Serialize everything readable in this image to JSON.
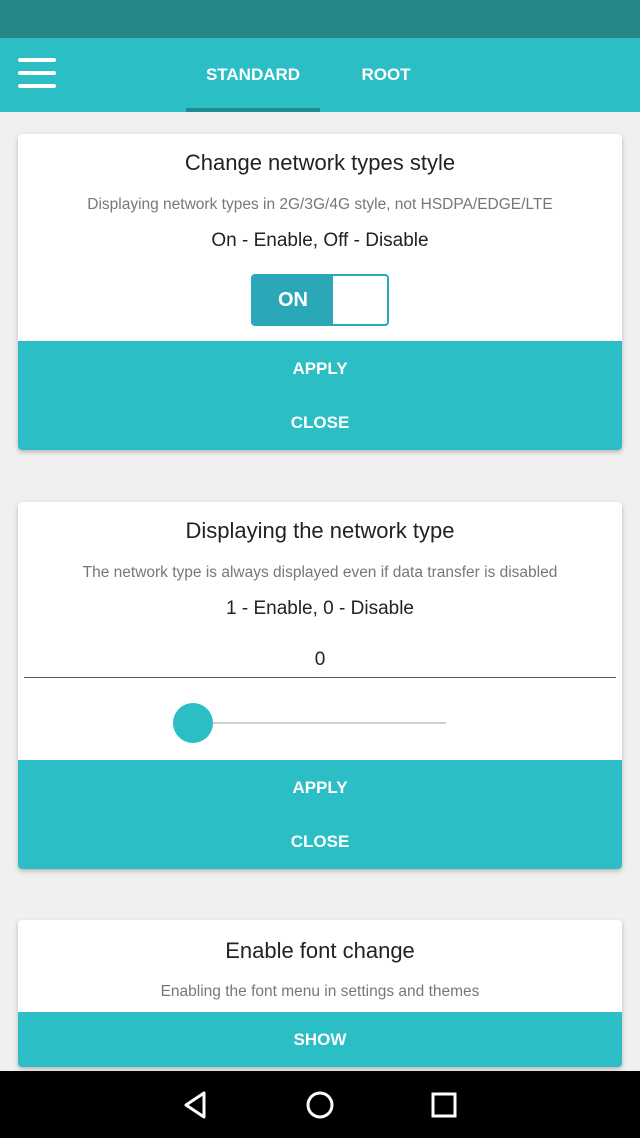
{
  "colors": {
    "status_bar": "#26878a",
    "primary": "#2bbec5",
    "tab_indicator": "#1e8c92",
    "toggle": "#2aa8b8",
    "nav_bar": "#000000"
  },
  "icons": {
    "menu": "hamburger-icon",
    "back": "back-triangle-icon",
    "home": "home-circle-icon",
    "recents": "recents-square-icon"
  },
  "tabs": [
    {
      "label": "STANDARD",
      "selected": true
    },
    {
      "label": "ROOT",
      "selected": false
    }
  ],
  "cards": [
    {
      "title": "Change network types style",
      "description": "Displaying network types in 2G/3G/4G style, not HSDPA/EDGE/LTE",
      "hint": "On - Enable, Off - Disable",
      "toggle_label": "ON",
      "apply_label": "APPLY",
      "close_label": "CLOSE"
    },
    {
      "title": "Displaying the network type",
      "description": "The network type is always displayed even if data transfer is disabled",
      "hint": "1 - Enable, 0 - Disable",
      "value": "0",
      "slider_fraction": 0,
      "apply_label": "APPLY",
      "close_label": "CLOSE"
    },
    {
      "title": "Enable font change",
      "description": "Enabling the font menu in settings and themes",
      "show_label": "SHOW"
    }
  ]
}
